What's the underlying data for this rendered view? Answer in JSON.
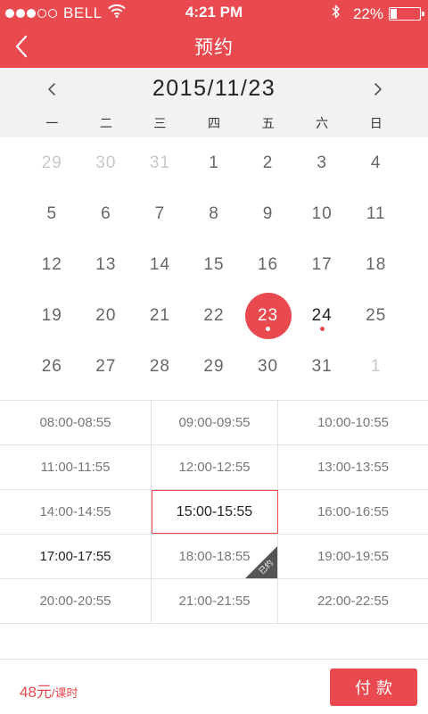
{
  "status": {
    "carrier": "BELL",
    "time": "4:21 PM",
    "battery_text": "22%",
    "battery_level": 0.22,
    "signal_bars": 3,
    "signal_total": 5,
    "icons": {
      "wifi": "wifi-icon",
      "bluetooth": "bluetooth-icon",
      "battery": "battery-icon"
    }
  },
  "header": {
    "title": "预约",
    "back_icon": "chevron-left-icon"
  },
  "calendar": {
    "month_label": "2015/11/23",
    "weekdays": [
      "一",
      "二",
      "三",
      "四",
      "五",
      "六",
      "日"
    ],
    "days": [
      {
        "n": "29",
        "state": "muted"
      },
      {
        "n": "30",
        "state": "muted"
      },
      {
        "n": "31",
        "state": "muted"
      },
      {
        "n": "1",
        "state": "normal"
      },
      {
        "n": "2",
        "state": "normal"
      },
      {
        "n": "3",
        "state": "normal"
      },
      {
        "n": "4",
        "state": "normal"
      },
      {
        "n": "5",
        "state": "normal"
      },
      {
        "n": "6",
        "state": "normal"
      },
      {
        "n": "7",
        "state": "normal"
      },
      {
        "n": "8",
        "state": "normal"
      },
      {
        "n": "9",
        "state": "normal"
      },
      {
        "n": "10",
        "state": "normal"
      },
      {
        "n": "11",
        "state": "normal"
      },
      {
        "n": "12",
        "state": "normal"
      },
      {
        "n": "13",
        "state": "normal"
      },
      {
        "n": "14",
        "state": "normal"
      },
      {
        "n": "15",
        "state": "normal"
      },
      {
        "n": "16",
        "state": "normal"
      },
      {
        "n": "17",
        "state": "normal"
      },
      {
        "n": "18",
        "state": "normal"
      },
      {
        "n": "19",
        "state": "normal"
      },
      {
        "n": "20",
        "state": "normal"
      },
      {
        "n": "21",
        "state": "normal"
      },
      {
        "n": "22",
        "state": "normal"
      },
      {
        "n": "23",
        "state": "selected",
        "marked": true
      },
      {
        "n": "24",
        "state": "avail",
        "marked": true
      },
      {
        "n": "25",
        "state": "normal"
      },
      {
        "n": "26",
        "state": "normal"
      },
      {
        "n": "27",
        "state": "normal"
      },
      {
        "n": "28",
        "state": "normal"
      },
      {
        "n": "29",
        "state": "normal"
      },
      {
        "n": "30",
        "state": "normal"
      },
      {
        "n": "31",
        "state": "normal"
      },
      {
        "n": "1",
        "state": "muted"
      }
    ]
  },
  "slots": [
    [
      {
        "label": "08:00-08:55"
      },
      {
        "label": "09:00-09:55"
      },
      {
        "label": "10:00-10:55"
      }
    ],
    [
      {
        "label": "11:00-11:55"
      },
      {
        "label": "12:00-12:55"
      },
      {
        "label": "13:00-13:55"
      }
    ],
    [
      {
        "label": "14:00-14:55"
      },
      {
        "label": "15:00-15:55",
        "state": "selected"
      },
      {
        "label": "16:00-16:55"
      }
    ],
    [
      {
        "label": "17:00-17:55",
        "state": "dark"
      },
      {
        "label": "18:00-18:55",
        "state": "booked",
        "badge": "已约"
      },
      {
        "label": "19:00-19:55"
      }
    ],
    [
      {
        "label": "20:00-20:55"
      },
      {
        "label": "21:00-21:55"
      },
      {
        "label": "22:00-22:55"
      }
    ]
  ],
  "footer": {
    "price_amount": "48元",
    "price_unit": "/课时",
    "pay_label": "付款"
  },
  "colors": {
    "accent": "#e84a4f",
    "header_bg": "#f2f2f2",
    "muted_text": "#c8c8c8",
    "booked_ribbon": "#555555"
  }
}
